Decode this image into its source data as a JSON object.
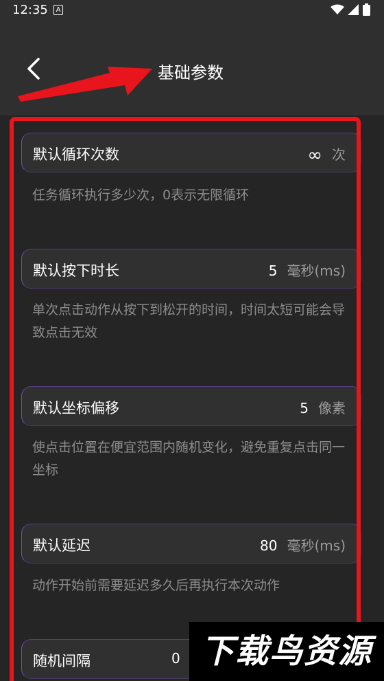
{
  "status_bar": {
    "time": "12:35",
    "notification_icon": "A"
  },
  "header": {
    "title": "基础参数",
    "back_icon": "chevron-left-icon"
  },
  "params": [
    {
      "label": "默认循环次数",
      "value": "∞",
      "unit": "次",
      "description": "任务循环执行多少次，0表示无限循环"
    },
    {
      "label": "默认按下时长",
      "value": "5",
      "unit": "毫秒(ms)",
      "description": "单次点击动作从按下到松开的时间，时间太短可能会导致点击无效"
    },
    {
      "label": "默认坐标偏移",
      "value": "5",
      "unit": "像素",
      "description": "使点击位置在便宜范围内随机变化，避免重复点击同一坐标"
    },
    {
      "label": "默认延迟",
      "value": "80",
      "unit": "毫秒(ms)",
      "description": "动作开始前需要延迟多久后再执行本次动作"
    },
    {
      "label": "随机间隔",
      "value": "0",
      "unit": ""
    }
  ],
  "watermark": {
    "text": "下载鸟资源"
  },
  "colors": {
    "annotation": "#e8151d",
    "row_border_accent": "#7b46c8",
    "background": "#252525",
    "header_background": "#2f2f2f"
  }
}
